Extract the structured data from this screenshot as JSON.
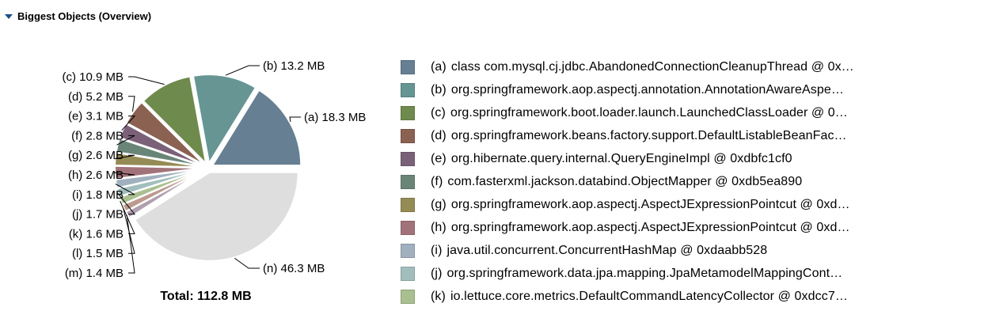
{
  "header": {
    "title": "Biggest Objects (Overview)",
    "expand_icon": "triangle-down-icon"
  },
  "total_label": "Total: 112.8 MB",
  "chart_data": {
    "type": "pie",
    "unit": "MB",
    "slices": [
      {
        "id": "(a)",
        "value": 18.3,
        "label": "18.3 MB",
        "color": "#667f93"
      },
      {
        "id": "(b)",
        "value": 13.2,
        "label": "13.2 MB",
        "color": "#669594"
      },
      {
        "id": "(c)",
        "value": 10.9,
        "label": "10.9 MB",
        "color": "#6f8a4d"
      },
      {
        "id": "(d)",
        "value": 5.2,
        "label": "5.2 MB",
        "color": "#8b6152"
      },
      {
        "id": "(e)",
        "value": 3.1,
        "label": "3.1 MB",
        "color": "#7a6178"
      },
      {
        "id": "(f)",
        "value": 2.8,
        "label": "2.8 MB",
        "color": "#698578"
      },
      {
        "id": "(g)",
        "value": 2.6,
        "label": "2.6 MB",
        "color": "#958b55"
      },
      {
        "id": "(h)",
        "value": 2.6,
        "label": "2.6 MB",
        "color": "#a2727a"
      },
      {
        "id": "(i)",
        "value": 1.8,
        "label": "1.8 MB",
        "color": "#a1b0be"
      },
      {
        "id": "(j)",
        "value": 1.7,
        "label": "1.7 MB",
        "color": "#a1bebd"
      },
      {
        "id": "(k)",
        "value": 1.6,
        "label": "1.6 MB",
        "color": "#aabf8f"
      },
      {
        "id": "(l)",
        "value": 1.5,
        "label": "1.5 MB",
        "color": "#bc9a8e"
      },
      {
        "id": "(m)",
        "value": 1.4,
        "label": "1.4 MB",
        "color": "#b09fae"
      },
      {
        "id": "(n)",
        "value": 46.3,
        "label": "46.3 MB",
        "color": "#dedede"
      }
    ],
    "legend": [
      {
        "id": "(a)",
        "text": "class com.mysql.cj.jdbc.AbandonedConnectionCleanupThread @ 0x…",
        "color": "#667f93"
      },
      {
        "id": "(b)",
        "text": "org.springframework.aop.aspectj.annotation.AnnotationAwareAspe…",
        "color": "#669594"
      },
      {
        "id": "(c)",
        "text": "org.springframework.boot.loader.launch.LaunchedClassLoader @ 0…",
        "color": "#6f8a4d"
      },
      {
        "id": "(d)",
        "text": "org.springframework.beans.factory.support.DefaultListableBeanFac…",
        "color": "#8b6152"
      },
      {
        "id": "(e)",
        "text": "org.hibernate.query.internal.QueryEngineImpl @ 0xdbfc1cf0",
        "color": "#7a6178"
      },
      {
        "id": "(f)",
        "text": "com.fasterxml.jackson.databind.ObjectMapper @ 0xdb5ea890",
        "color": "#698578"
      },
      {
        "id": "(g)",
        "text": "org.springframework.aop.aspectj.AspectJExpressionPointcut @ 0xd…",
        "color": "#958b55"
      },
      {
        "id": "(h)",
        "text": "org.springframework.aop.aspectj.AspectJExpressionPointcut @ 0xd…",
        "color": "#a2727a"
      },
      {
        "id": "(i)",
        "text": "java.util.concurrent.ConcurrentHashMap @ 0xdaabb528",
        "color": "#a1b0be"
      },
      {
        "id": "(j)",
        "text": "org.springframework.data.jpa.mapping.JpaMetamodelMappingCont…",
        "color": "#a1bebd"
      },
      {
        "id": "(k)",
        "text": "io.lettuce.core.metrics.DefaultCommandLatencyCollector @ 0xdcc7…",
        "color": "#aabf8f"
      }
    ]
  }
}
